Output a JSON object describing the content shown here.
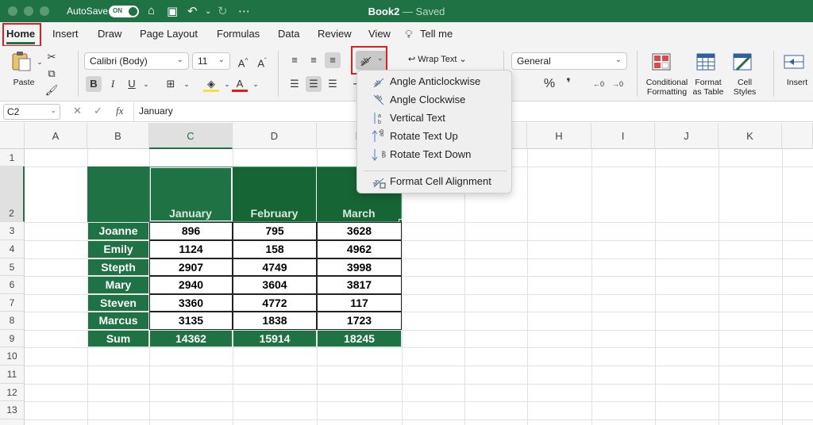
{
  "titlebar": {
    "autosave_label": "AutoSave",
    "autosave_state": "ON",
    "doc_title": "Book2",
    "doc_status": "— Saved"
  },
  "ribbon_tabs": [
    "Home",
    "Insert",
    "Draw",
    "Page Layout",
    "Formulas",
    "Data",
    "Review",
    "View",
    "Tell me"
  ],
  "ribbon": {
    "paste_label": "Paste",
    "font_name": "Calibri (Body)",
    "font_size": "11",
    "bold": "B",
    "italic": "I",
    "underline": "U",
    "wrap_text": "Wrap Text",
    "number_format": "General",
    "percent": "%",
    "comma": "❜",
    "conditional_formatting": [
      "Conditional",
      "Formatting"
    ],
    "format_as_table": [
      "Format",
      "as Table"
    ],
    "cell_styles": [
      "Cell",
      "Styles"
    ],
    "insert": "Insert"
  },
  "formula_bar": {
    "name_box": "C2",
    "fx": "fx",
    "content": "January"
  },
  "columns": [
    "A",
    "B",
    "C",
    "D",
    "E",
    "F",
    "G",
    "H",
    "I",
    "J",
    "K"
  ],
  "rows": [
    "1",
    "2",
    "3",
    "4",
    "5",
    "6",
    "7",
    "8",
    "9",
    "10",
    "11",
    "12",
    "13"
  ],
  "sheet": {
    "headers": [
      "January",
      "February",
      "March"
    ],
    "rows": [
      {
        "name": "Joanne",
        "values": [
          "896",
          "795",
          "3628"
        ]
      },
      {
        "name": "Emily",
        "values": [
          "1124",
          "158",
          "4962"
        ]
      },
      {
        "name": "Stepth",
        "values": [
          "2907",
          "4749",
          "3998"
        ]
      },
      {
        "name": "Mary",
        "values": [
          "2940",
          "3604",
          "3817"
        ]
      },
      {
        "name": "Steven",
        "values": [
          "3360",
          "4772",
          "117"
        ]
      },
      {
        "name": "Marcus",
        "values": [
          "3135",
          "1838",
          "1723"
        ]
      },
      {
        "name": "Sum",
        "values": [
          "14362",
          "15914",
          "18245"
        ]
      }
    ]
  },
  "orientation_menu": {
    "items": [
      "Angle Anticlockwise",
      "Angle Clockwise",
      "Vertical Text",
      "Rotate Text Up",
      "Rotate Text Down"
    ],
    "footer_item": "Format Cell Alignment"
  },
  "colors": {
    "excel_green": "#1f7244",
    "highlight_red": "#e02020",
    "header_green_dark": "#166534"
  }
}
